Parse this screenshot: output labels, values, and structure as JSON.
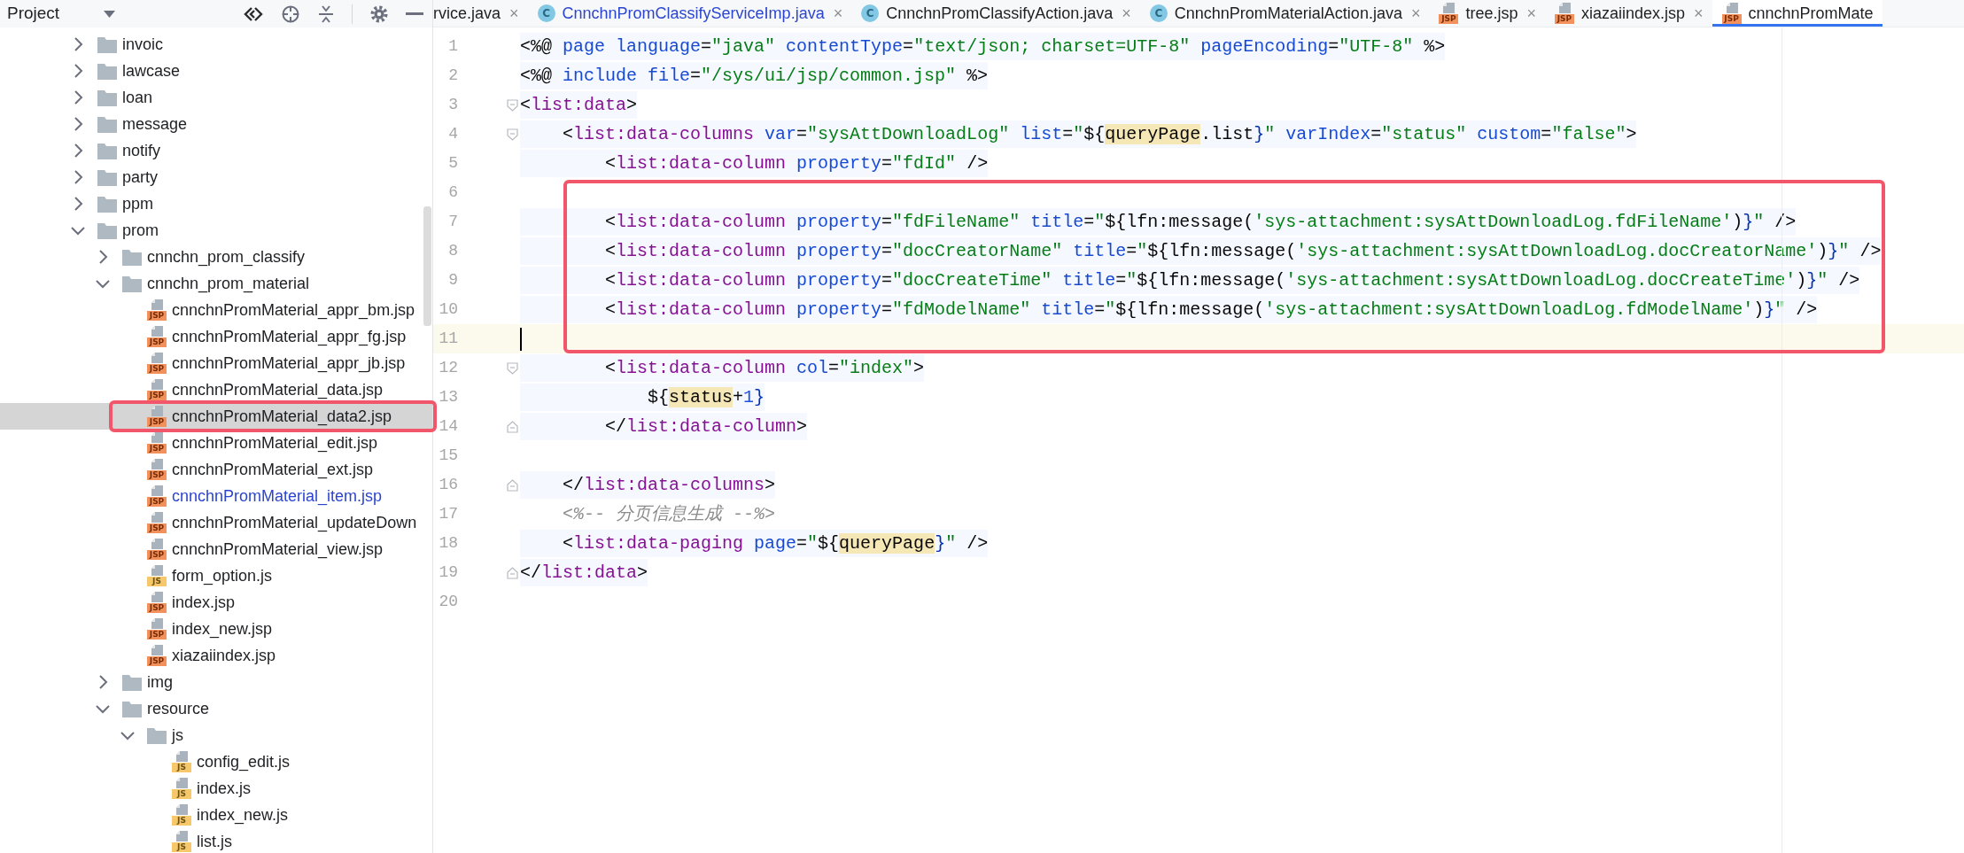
{
  "project_panel": {
    "title": "Project",
    "tree": [
      {
        "label": "invoic",
        "kind": "folder",
        "expanded": false,
        "selected": false,
        "highlighted": false
      },
      {
        "label": "lawcase",
        "kind": "folder",
        "expanded": false,
        "selected": false,
        "highlighted": false
      },
      {
        "label": "loan",
        "kind": "folder",
        "expanded": false,
        "selected": false,
        "highlighted": false
      },
      {
        "label": "message",
        "kind": "folder",
        "expanded": false,
        "selected": false,
        "highlighted": false
      },
      {
        "label": "notify",
        "kind": "folder",
        "expanded": false,
        "selected": false,
        "highlighted": false
      },
      {
        "label": "party",
        "kind": "folder",
        "expanded": false,
        "selected": false,
        "highlighted": false
      },
      {
        "label": "ppm",
        "kind": "folder",
        "expanded": false,
        "selected": false,
        "highlighted": false
      },
      {
        "label": "prom",
        "kind": "folder",
        "expanded": true,
        "selected": false,
        "highlighted": false,
        "children": [
          {
            "label": "cnnchn_prom_classify",
            "kind": "folder",
            "expanded": false,
            "selected": false,
            "highlighted": false
          },
          {
            "label": "cnnchn_prom_material",
            "kind": "folder",
            "expanded": true,
            "selected": false,
            "highlighted": false,
            "children": [
              {
                "label": "cnnchnPromMaterial_appr_bm.jsp",
                "kind": "file",
                "badge": "JSP",
                "modified": false,
                "selected": false,
                "highlighted": false
              },
              {
                "label": "cnnchnPromMaterial_appr_fg.jsp",
                "kind": "file",
                "badge": "JSP",
                "modified": false,
                "selected": false,
                "highlighted": false
              },
              {
                "label": "cnnchnPromMaterial_appr_jb.jsp",
                "kind": "file",
                "badge": "JSP",
                "modified": false,
                "selected": false,
                "highlighted": false
              },
              {
                "label": "cnnchnPromMaterial_data.jsp",
                "kind": "file",
                "badge": "JSP",
                "modified": false,
                "selected": false,
                "highlighted": false
              },
              {
                "label": "cnnchnPromMaterial_data2.jsp",
                "kind": "file",
                "badge": "JSP",
                "modified": false,
                "selected": true,
                "highlighted": true
              },
              {
                "label": "cnnchnPromMaterial_edit.jsp",
                "kind": "file",
                "badge": "JSP",
                "modified": false,
                "selected": false,
                "highlighted": false
              },
              {
                "label": "cnnchnPromMaterial_ext.jsp",
                "kind": "file",
                "badge": "JSP",
                "modified": false,
                "selected": false,
                "highlighted": false
              },
              {
                "label": "cnnchnPromMaterial_item.jsp",
                "kind": "file",
                "badge": "JSP",
                "modified": true,
                "selected": false,
                "highlighted": false
              },
              {
                "label": "cnnchnPromMaterial_updateDown",
                "kind": "file",
                "badge": "JSP",
                "modified": false,
                "selected": false,
                "highlighted": false
              },
              {
                "label": "cnnchnPromMaterial_view.jsp",
                "kind": "file",
                "badge": "JSP",
                "modified": false,
                "selected": false,
                "highlighted": false
              },
              {
                "label": "form_option.js",
                "kind": "file",
                "badge": "JS",
                "modified": false,
                "selected": false,
                "highlighted": false
              },
              {
                "label": "index.jsp",
                "kind": "file",
                "badge": "JSP",
                "modified": false,
                "selected": false,
                "highlighted": false
              },
              {
                "label": "index_new.jsp",
                "kind": "file",
                "badge": "JSP",
                "modified": false,
                "selected": false,
                "highlighted": false
              },
              {
                "label": "xiazaiindex.jsp",
                "kind": "file",
                "badge": "JSP",
                "modified": false,
                "selected": false,
                "highlighted": false
              }
            ]
          },
          {
            "label": "img",
            "kind": "folder",
            "expanded": false,
            "selected": false,
            "highlighted": false
          },
          {
            "label": "resource",
            "kind": "folder",
            "expanded": true,
            "selected": false,
            "highlighted": false,
            "children": [
              {
                "label": "js",
                "kind": "folder",
                "expanded": true,
                "selected": false,
                "highlighted": false,
                "children": [
                  {
                    "label": "config_edit.js",
                    "kind": "file",
                    "badge": "JS",
                    "modified": false,
                    "selected": false,
                    "highlighted": false
                  },
                  {
                    "label": "index.js",
                    "kind": "file",
                    "badge": "JS",
                    "modified": false,
                    "selected": false,
                    "highlighted": false
                  },
                  {
                    "label": "index_new.js",
                    "kind": "file",
                    "badge": "JS",
                    "modified": false,
                    "selected": false,
                    "highlighted": false
                  },
                  {
                    "label": "list.js",
                    "kind": "file",
                    "badge": "JS",
                    "modified": false,
                    "selected": false,
                    "highlighted": false
                  }
                ]
              }
            ]
          }
        ]
      }
    ]
  },
  "tabs": [
    {
      "label": "rvice.java",
      "kind": "plain",
      "modified": false,
      "selected": false,
      "close": "×"
    },
    {
      "label": "CnnchnPromClassifyServiceImp.java",
      "kind": "class",
      "icon": "C",
      "modified": true,
      "selected": false,
      "close": "×"
    },
    {
      "label": "CnnchnPromClassifyAction.java",
      "kind": "class",
      "icon": "C",
      "modified": false,
      "selected": false,
      "close": "×"
    },
    {
      "label": "CnnchnPromMaterialAction.java",
      "kind": "class",
      "icon": "C",
      "modified": false,
      "selected": false,
      "close": "×"
    },
    {
      "label": "tree.jsp",
      "kind": "jsp",
      "icon": "JSP",
      "modified": false,
      "selected": false,
      "close": "×"
    },
    {
      "label": "xiazaiindex.jsp",
      "kind": "jsp",
      "icon": "JSP",
      "modified": false,
      "selected": false,
      "close": "×"
    },
    {
      "label": "cnnchnPromMate",
      "kind": "jsp",
      "icon": "JSP",
      "modified": false,
      "selected": true
    }
  ],
  "editor": {
    "lines": [
      {
        "number": "1",
        "kind": "markup",
        "current": false,
        "tokens": [
          {
            "text": "<%@ ",
            "kind": "punct"
          },
          {
            "text": "page ",
            "kind": "attr"
          },
          {
            "text": "language",
            "kind": "attr"
          },
          {
            "text": "=",
            "kind": "punct"
          },
          {
            "text": "\"java\"",
            "kind": "value"
          },
          {
            "text": " contentType",
            "kind": "attr"
          },
          {
            "text": "=",
            "kind": "punct"
          },
          {
            "text": "\"text/json; charset=UTF-8\"",
            "kind": "value"
          },
          {
            "text": " pageEncoding",
            "kind": "attr"
          },
          {
            "text": "=",
            "kind": "punct"
          },
          {
            "text": "\"UTF-8\"",
            "kind": "value"
          },
          {
            "text": " %>",
            "kind": "punct"
          }
        ]
      },
      {
        "number": "2",
        "kind": "markup",
        "current": false,
        "tokens": [
          {
            "text": "<%@ ",
            "kind": "punct"
          },
          {
            "text": "include ",
            "kind": "attr"
          },
          {
            "text": "file",
            "kind": "attr"
          },
          {
            "text": "=",
            "kind": "punct"
          },
          {
            "text": "\"/sys/ui/jsp/common.jsp\"",
            "kind": "value"
          },
          {
            "text": " %>",
            "kind": "punct"
          }
        ]
      },
      {
        "number": "3",
        "kind": "markup",
        "current": false,
        "fold": {
          "kind": "start"
        },
        "tokens": [
          {
            "text": "<",
            "kind": "punct"
          },
          {
            "text": "list:data",
            "kind": "tag"
          },
          {
            "text": ">",
            "kind": "punct"
          }
        ]
      },
      {
        "number": "4",
        "kind": "markup",
        "current": false,
        "fold": {
          "kind": "start"
        },
        "tokens": [
          {
            "text": "    <",
            "kind": "punct"
          },
          {
            "text": "list:data-columns",
            "kind": "tag"
          },
          {
            "text": " var",
            "kind": "attr"
          },
          {
            "text": "=",
            "kind": "punct"
          },
          {
            "text": "\"sysAttDownloadLog\"",
            "kind": "value"
          },
          {
            "text": " list",
            "kind": "attr"
          },
          {
            "text": "=",
            "kind": "punct"
          },
          {
            "text": "\"",
            "kind": "value"
          },
          {
            "text": "${",
            "kind": "punct"
          },
          {
            "text": "queryPage",
            "kind": "match"
          },
          {
            "text": ".list",
            "kind": "punct"
          },
          {
            "text": "}",
            "kind": "brace"
          },
          {
            "text": "\"",
            "kind": "value"
          },
          {
            "text": " varIndex",
            "kind": "attr"
          },
          {
            "text": "=",
            "kind": "punct"
          },
          {
            "text": "\"status\"",
            "kind": "value"
          },
          {
            "text": " custom",
            "kind": "attr"
          },
          {
            "text": "=",
            "kind": "punct"
          },
          {
            "text": "\"false\"",
            "kind": "value"
          },
          {
            "text": ">",
            "kind": "punct"
          }
        ]
      },
      {
        "number": "5",
        "kind": "markup",
        "current": false,
        "tokens": [
          {
            "text": "        <",
            "kind": "punct"
          },
          {
            "text": "list:data-column",
            "kind": "tag"
          },
          {
            "text": " property",
            "kind": "attr"
          },
          {
            "text": "=",
            "kind": "punct"
          },
          {
            "text": "\"fdId\"",
            "kind": "value"
          },
          {
            "text": " />",
            "kind": "punct"
          }
        ]
      },
      {
        "kind": "frame",
        "lines": [
          {
            "number": "6",
            "kind": "blank",
            "current": false
          },
          {
            "number": "7",
            "kind": "markup",
            "current": false,
            "tokens": [
              {
                "text": "        <",
                "kind": "punct"
              },
              {
                "text": "list:data-column",
                "kind": "tag"
              },
              {
                "text": " property",
                "kind": "attr"
              },
              {
                "text": "=",
                "kind": "punct"
              },
              {
                "text": "\"fdFileName\"",
                "kind": "value"
              },
              {
                "text": " title",
                "kind": "attr"
              },
              {
                "text": "=",
                "kind": "punct"
              },
              {
                "text": "\"",
                "kind": "value"
              },
              {
                "text": "${lfn:message(",
                "kind": "punct"
              },
              {
                "text": "'sys-attachment:sysAttDownloadLog.fdFileName'",
                "kind": "value"
              },
              {
                "text": ")",
                "kind": "punct"
              },
              {
                "text": "}",
                "kind": "brace"
              },
              {
                "text": "\"",
                "kind": "value"
              },
              {
                "text": " />",
                "kind": "punct"
              }
            ]
          },
          {
            "number": "8",
            "kind": "markup",
            "current": false,
            "tokens": [
              {
                "text": "        <",
                "kind": "punct"
              },
              {
                "text": "list:data-column",
                "kind": "tag"
              },
              {
                "text": " property",
                "kind": "attr"
              },
              {
                "text": "=",
                "kind": "punct"
              },
              {
                "text": "\"docCreatorName\"",
                "kind": "value"
              },
              {
                "text": " title",
                "kind": "attr"
              },
              {
                "text": "=",
                "kind": "punct"
              },
              {
                "text": "\"",
                "kind": "value"
              },
              {
                "text": "${lfn:message(",
                "kind": "punct"
              },
              {
                "text": "'sys-attachment:sysAttDownloadLog.docCreatorName'",
                "kind": "value"
              },
              {
                "text": ")",
                "kind": "punct"
              },
              {
                "text": "}",
                "kind": "brace"
              },
              {
                "text": "\"",
                "kind": "value"
              },
              {
                "text": " />",
                "kind": "punct"
              }
            ]
          },
          {
            "number": "9",
            "kind": "markup",
            "current": false,
            "tokens": [
              {
                "text": "        <",
                "kind": "punct"
              },
              {
                "text": "list:data-column",
                "kind": "tag"
              },
              {
                "text": " property",
                "kind": "attr"
              },
              {
                "text": "=",
                "kind": "punct"
              },
              {
                "text": "\"docCreateTime\"",
                "kind": "value"
              },
              {
                "text": " title",
                "kind": "attr"
              },
              {
                "text": "=",
                "kind": "punct"
              },
              {
                "text": "\"",
                "kind": "value"
              },
              {
                "text": "${lfn:message(",
                "kind": "punct"
              },
              {
                "text": "'sys-attachment:sysAttDownloadLog.docCreateTime'",
                "kind": "value"
              },
              {
                "text": ")",
                "kind": "punct"
              },
              {
                "text": "}",
                "kind": "brace"
              },
              {
                "text": "\"",
                "kind": "value"
              },
              {
                "text": " />",
                "kind": "punct"
              }
            ]
          },
          {
            "number": "10",
            "kind": "markup",
            "current": false,
            "tokens": [
              {
                "text": "        <",
                "kind": "punct"
              },
              {
                "text": "list:data-column",
                "kind": "tag"
              },
              {
                "text": " property",
                "kind": "attr"
              },
              {
                "text": "=",
                "kind": "punct"
              },
              {
                "text": "\"fdModelName\"",
                "kind": "value"
              },
              {
                "text": " title",
                "kind": "attr"
              },
              {
                "text": "=",
                "kind": "punct"
              },
              {
                "text": "\"",
                "kind": "value"
              },
              {
                "text": "${lfn:message(",
                "kind": "punct"
              },
              {
                "text": "'sys-attachment:sysAttDownloadLog.fdModelName'",
                "kind": "value"
              },
              {
                "text": ")",
                "kind": "punct"
              },
              {
                "text": "}",
                "kind": "brace"
              },
              {
                "text": "\"",
                "kind": "value"
              },
              {
                "text": " />",
                "kind": "punct"
              }
            ]
          },
          {
            "number": "11",
            "kind": "blank",
            "current": true
          }
        ]
      },
      {
        "number": "12",
        "kind": "markup",
        "current": false,
        "fold": {
          "kind": "start"
        },
        "tokens": [
          {
            "text": "        <",
            "kind": "punct"
          },
          {
            "text": "list:data-column",
            "kind": "tag"
          },
          {
            "text": " col",
            "kind": "attr"
          },
          {
            "text": "=",
            "kind": "punct"
          },
          {
            "text": "\"index\"",
            "kind": "value"
          },
          {
            "text": ">",
            "kind": "punct"
          }
        ]
      },
      {
        "number": "13",
        "kind": "markup",
        "current": false,
        "tokens": [
          {
            "text": "            ${",
            "kind": "punct"
          },
          {
            "text": "status",
            "kind": "match"
          },
          {
            "text": "+",
            "kind": "punct"
          },
          {
            "text": "1",
            "kind": "number"
          },
          {
            "text": "}",
            "kind": "brace"
          }
        ]
      },
      {
        "number": "14",
        "kind": "markup",
        "current": false,
        "fold": {
          "kind": "end"
        },
        "tokens": [
          {
            "text": "        </",
            "kind": "punct"
          },
          {
            "text": "list:data-column",
            "kind": "tag"
          },
          {
            "text": ">",
            "kind": "punct"
          }
        ]
      },
      {
        "number": "15",
        "kind": "blank",
        "current": false
      },
      {
        "number": "16",
        "kind": "markup",
        "current": false,
        "fold": {
          "kind": "end"
        },
        "tokens": [
          {
            "text": "    </",
            "kind": "punct"
          },
          {
            "text": "list:data-columns",
            "kind": "tag"
          },
          {
            "text": ">",
            "kind": "punct"
          }
        ]
      },
      {
        "number": "17",
        "kind": "comment",
        "current": false,
        "tokens": [
          {
            "text": "    <%-- 分页信息生成 --%>",
            "kind": "comment"
          }
        ]
      },
      {
        "number": "18",
        "kind": "markup",
        "current": false,
        "tokens": [
          {
            "text": "    <",
            "kind": "punct"
          },
          {
            "text": "list:data-paging",
            "kind": "tag"
          },
          {
            "text": " page",
            "kind": "attr"
          },
          {
            "text": "=",
            "kind": "punct"
          },
          {
            "text": "\"",
            "kind": "value"
          },
          {
            "text": "${",
            "kind": "punct"
          },
          {
            "text": "queryPage",
            "kind": "match"
          },
          {
            "text": "}",
            "kind": "brace"
          },
          {
            "text": "\"",
            "kind": "value"
          },
          {
            "text": " />",
            "kind": "punct"
          }
        ]
      },
      {
        "number": "19",
        "kind": "markup",
        "current": false,
        "fold": {
          "kind": "end"
        },
        "tokens": [
          {
            "text": "</",
            "kind": "punct"
          },
          {
            "text": "list:data",
            "kind": "tag"
          },
          {
            "text": ">",
            "kind": "punct"
          }
        ]
      },
      {
        "number": "20",
        "kind": "blank",
        "current": false
      }
    ]
  }
}
